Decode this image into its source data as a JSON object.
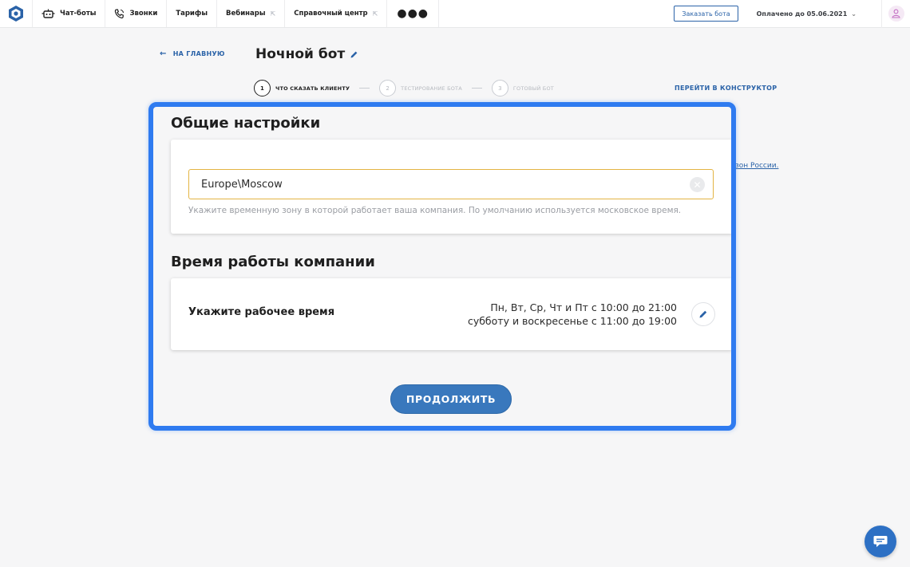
{
  "nav": {
    "items": [
      {
        "label": "Чат-боты",
        "icon": "robot-icon"
      },
      {
        "label": "Звонки",
        "icon": "phone-icon"
      },
      {
        "label": "Тарифы"
      },
      {
        "label": "Вебинары",
        "icon_after": "external-link-icon"
      },
      {
        "label": "Справочный центр",
        "icon_after": "external-link-icon"
      }
    ],
    "more_label": "●●●",
    "order_button": "Заказать бота",
    "paid_until": "Оплачено до 05.06.2021",
    "paid_chevron": "⌄",
    "external_glyph": "⇱"
  },
  "header": {
    "back_arrow": "←",
    "back_label": "НА ГЛАВНУЮ",
    "title": "Ночной бот",
    "constructor_link": "ПЕРЕЙТИ В КОНСТРУКТОР",
    "steps": [
      {
        "num": "1",
        "label": "ЧТО СКАЗАТЬ КЛИЕНТУ",
        "state": "active"
      },
      {
        "num": "2",
        "label": "ТЕСТИРОВАНИЕ БОТА",
        "state": "inactive"
      },
      {
        "num": "3",
        "label": "ГОТОВЫЙ БОТ",
        "state": "inactive"
      }
    ]
  },
  "background_link": "зон России.",
  "general": {
    "title": "Общие настройки",
    "timezone_value": "Europe\\Moscow",
    "clear_glyph": "✕",
    "hint": "Укажите временную зону в которой работает ваша компания. По умолчанию используется московское время."
  },
  "hours": {
    "title": "Время работы компании",
    "label": "Укажите рабочее время",
    "line1": "Пн, Вт, Ср, Чт и Пт с 10:00 до 21:00",
    "line2": "субботу и воскресенье с 11:00 до 19:00"
  },
  "continue_label": "ПРОДОЛЖИТЬ",
  "colors": {
    "accent": "#2b63a8",
    "highlight": "#2f7bf0",
    "button": "#3978bd",
    "input_border": "#e3b443"
  }
}
